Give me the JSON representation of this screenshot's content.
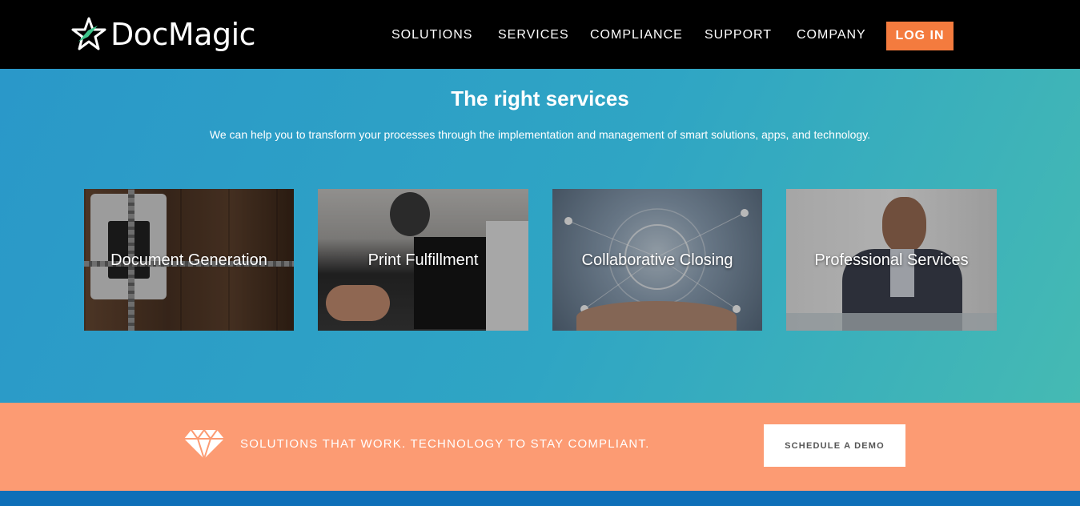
{
  "brand": {
    "name": "DocMagic"
  },
  "nav": {
    "links": [
      "SOLUTIONS",
      "SERVICES",
      "COMPLIANCE",
      "SUPPORT",
      "COMPANY"
    ],
    "login_label": "LOG IN",
    "accent": "#f47b3e"
  },
  "hero": {
    "title": "The right services",
    "subtitle": "We can help you to transform your processes through the implementation and management of smart solutions, apps, and technology.",
    "cards": [
      {
        "label": "Document Generation",
        "image": "tablet-chained-lock-photo"
      },
      {
        "label": "Print Fulfillment",
        "image": "printer-maintenance-photo"
      },
      {
        "label": "Collaborative Closing",
        "image": "network-hands-photo"
      },
      {
        "label": "Professional Services",
        "image": "businessman-phone-photo"
      }
    ]
  },
  "cta": {
    "icon": "diamond-icon",
    "text": "SOLUTIONS THAT WORK. TECHNOLOGY TO STAY COMPLIANT.",
    "button_label": "SCHEDULE A DEMO",
    "background": "#fc9b73"
  }
}
